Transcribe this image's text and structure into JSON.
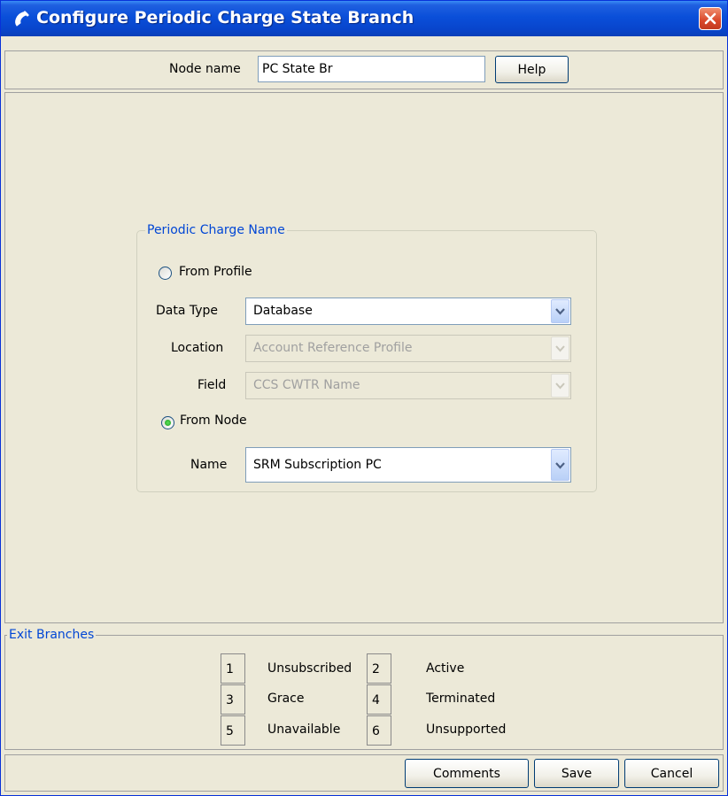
{
  "window": {
    "title": "Configure Periodic Charge State Branch",
    "icon": "phone-handset-icon",
    "close_icon": "close-icon"
  },
  "header": {
    "node_name_label": "Node name",
    "node_name_value": "PC State Br",
    "help_label": "Help"
  },
  "periodic_charge": {
    "group_title": "Periodic Charge Name",
    "from_profile_label": "From Profile",
    "from_profile_selected": false,
    "data_type_label": "Data Type",
    "data_type_value": "Database",
    "location_label": "Location",
    "location_value": "Account Reference Profile",
    "field_label": "Field",
    "field_value": "CCS CWTR Name",
    "from_node_label": "From Node",
    "from_node_selected": true,
    "name_label": "Name",
    "name_value": "SRM Subscription PC"
  },
  "exit_branches": {
    "title": "Exit Branches",
    "rows": [
      [
        {
          "num": "1",
          "label": "Unsubscribed"
        },
        {
          "num": "2",
          "label": "Active"
        }
      ],
      [
        {
          "num": "3",
          "label": "Grace"
        },
        {
          "num": "4",
          "label": "Terminated"
        }
      ],
      [
        {
          "num": "5",
          "label": "Unavailable"
        },
        {
          "num": "6",
          "label": "Unsupported"
        }
      ]
    ]
  },
  "footer": {
    "comments_label": "Comments",
    "save_label": "Save",
    "cancel_label": "Cancel"
  },
  "colors": {
    "titlebar": "#0a4fd9",
    "window_bg": "#ece9d8",
    "group_title": "#0046d5",
    "close_button": "#d9472a"
  }
}
